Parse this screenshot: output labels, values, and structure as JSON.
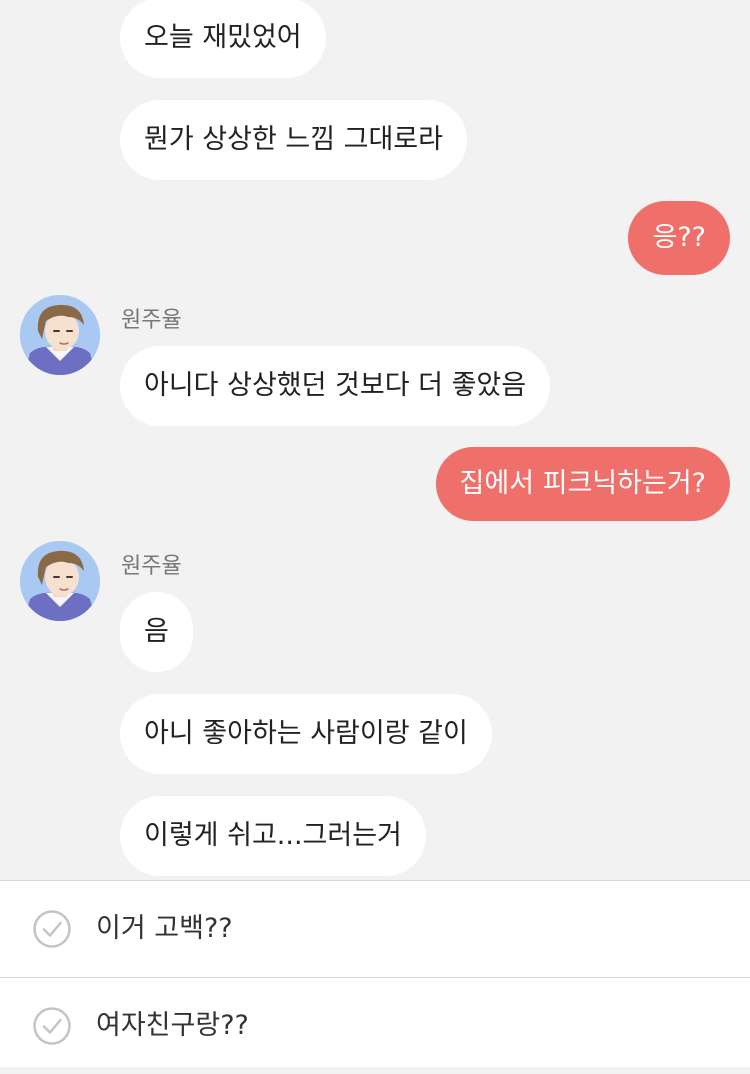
{
  "chat": {
    "contact_name": "원주율",
    "messages": [
      {
        "from": "them",
        "text": "오늘 재밌었어"
      },
      {
        "from": "them",
        "text": "뭔가 상상한 느낌 그대로라"
      },
      {
        "from": "me",
        "text": "응??"
      },
      {
        "from": "them",
        "text": "아니다 상상했던 것보다 더 좋았음"
      },
      {
        "from": "me",
        "text": "집에서 피크닉하는거?"
      },
      {
        "from": "them",
        "text": "음"
      },
      {
        "from": "them",
        "text": "아니 좋아하는 사람이랑 같이"
      },
      {
        "from": "them",
        "text": "이렇게 쉬고...그러는거"
      }
    ]
  },
  "reply_options": [
    {
      "label": "이거 고백??",
      "icon": "check-circle-icon"
    },
    {
      "label": "여자친구랑??",
      "icon": "check-circle-icon"
    }
  ],
  "colors": {
    "background": "#f2f2f2",
    "incoming_bubble": "#ffffff",
    "outgoing_bubble": "#ef706a",
    "outgoing_text": "#ffffff"
  }
}
